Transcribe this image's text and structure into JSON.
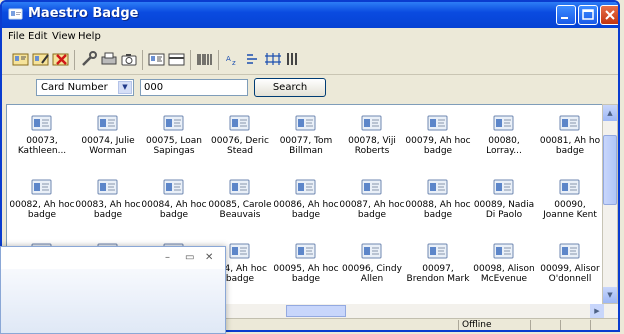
{
  "window": {
    "title": "Maestro Badge"
  },
  "menu": [
    {
      "label": "File"
    },
    {
      "label": "Edit"
    },
    {
      "label": "View"
    },
    {
      "label": "Help"
    }
  ],
  "toolbar": {
    "icons": [
      "new-badge-icon",
      "edit-badge-icon",
      "delete-badge-icon",
      "tools-icon",
      "print-icon",
      "camera-icon",
      "card-front-icon",
      "card-back-icon",
      "barcode-icon",
      "sort-icon",
      "filter-icon",
      "grid-view-icon",
      "details-view-icon"
    ]
  },
  "search": {
    "field_label": "Card Number",
    "query": "000",
    "button_label": "Search"
  },
  "items": [
    {
      "line1": "00073,",
      "line2": "Kathleen..."
    },
    {
      "line1": "00074, Julie",
      "line2": "Worman"
    },
    {
      "line1": "00075, Loan",
      "line2": "Sapingas"
    },
    {
      "line1": "00076, Deric",
      "line2": "Stead"
    },
    {
      "line1": "00077, Tom",
      "line2": "Billman"
    },
    {
      "line1": "00078, Viji",
      "line2": "Roberts"
    },
    {
      "line1": "00079, Ah hoc",
      "line2": "badge"
    },
    {
      "line1": "00080,",
      "line2": "Lorray..."
    },
    {
      "line1": "00081, Ah ho",
      "line2": "badge"
    },
    {
      "line1": "00082, Ah hoc",
      "line2": "badge"
    },
    {
      "line1": "00083, Ah hoc",
      "line2": "badge"
    },
    {
      "line1": "00084, Ah hoc",
      "line2": "badge"
    },
    {
      "line1": "00085, Carole",
      "line2": "Beauvais"
    },
    {
      "line1": "00086, Ah hoc",
      "line2": "badge"
    },
    {
      "line1": "00087, Ah hoc",
      "line2": "badge"
    },
    {
      "line1": "00088, Ah hoc",
      "line2": "badge"
    },
    {
      "line1": "00089, Nadia",
      "line2": "Di Paolo"
    },
    {
      "line1": "00090,",
      "line2": "Joanne Kent"
    },
    {
      "line1": "",
      "line2": ""
    },
    {
      "line1": "",
      "line2": ""
    },
    {
      "line1": "",
      "line2": ""
    },
    {
      "line1": "094, Ah hoc",
      "line2": "badge"
    },
    {
      "line1": "00095, Ah hoc",
      "line2": "badge"
    },
    {
      "line1": "00096, Cindy",
      "line2": "Allen"
    },
    {
      "line1": "00097,",
      "line2": "Brendon Mark"
    },
    {
      "line1": "00098, Alison",
      "line2": "McEvenue"
    },
    {
      "line1": "00099, Alisor",
      "line2": "O'donnell"
    }
  ],
  "status": {
    "connection": "Offline"
  },
  "overlay_window": {
    "minimize": "–",
    "maximize": "▭",
    "close": "✕"
  },
  "colors": {
    "titlebar": "#0a4be0",
    "window_bg": "#ece9d8",
    "list_bg": "#ffffff"
  }
}
